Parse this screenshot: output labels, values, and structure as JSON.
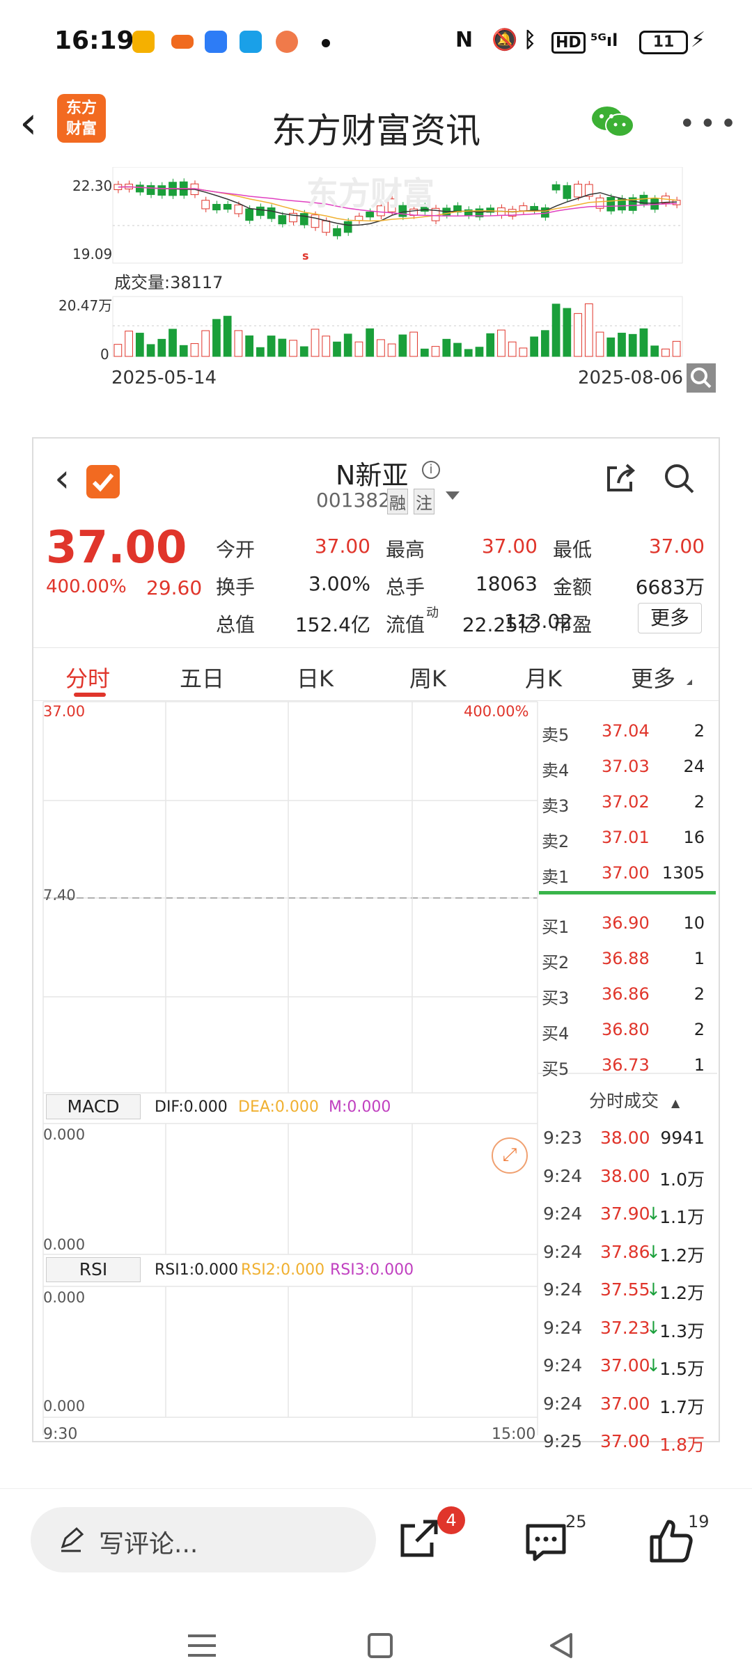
{
  "status": {
    "time": "16:19",
    "battery": "11"
  },
  "nav": {
    "title": "东方财富资讯",
    "logo_line1": "东方",
    "logo_line2": "财富"
  },
  "top_chart": {
    "watermark": "东方财富",
    "price_high": "22.30",
    "price_low": "19.09",
    "marker": "s",
    "volume_label": "成交量:38117",
    "vol_max": "20.47万",
    "vol_min": "0",
    "date_start": "2025-05-14",
    "date_end": "2025-08-06"
  },
  "stock": {
    "name": "N新亚",
    "code": "001382",
    "tag1": "融",
    "tag2": "注",
    "price": "37.00",
    "change_pct": "400.00%",
    "change": "29.60",
    "rows": [
      {
        "l1": "今开",
        "v1": "37.00",
        "l2": "最高",
        "v2": "37.00",
        "l3": "最低",
        "v3": "37.00"
      },
      {
        "l1": "换手",
        "v1": "3.00%",
        "l2": "总手",
        "v2": "18063",
        "l3": "金额",
        "v3": "6683万"
      },
      {
        "l1": "总值",
        "v1": "152.4亿",
        "l2": "流值",
        "v2": "22.25亿",
        "l3": "市盈",
        "v3": "113.02"
      }
    ],
    "pe_sup": "动",
    "more_button": "更多"
  },
  "tabs": [
    "分时",
    "五日",
    "日K",
    "周K",
    "月K",
    "更多"
  ],
  "intraday": {
    "top_left": "37.00",
    "top_right": "400.00%",
    "mid": "7.40",
    "time_start": "9:30",
    "time_end": "15:00"
  },
  "macd": {
    "label": "MACD",
    "dif": "DIF:0.000",
    "dea": "DEA:0.000",
    "m": "M:0.000",
    "top": "0.000",
    "bottom": "0.000"
  },
  "rsi": {
    "label": "RSI",
    "r1": "RSI1:0.000",
    "r2": "RSI2:0.000",
    "r3": "RSI3:0.000",
    "top": "0.000",
    "bottom": "0.000"
  },
  "order_book": {
    "sells": [
      {
        "label": "卖5",
        "price": "37.04",
        "vol": "2"
      },
      {
        "label": "卖4",
        "price": "37.03",
        "vol": "24"
      },
      {
        "label": "卖3",
        "price": "37.02",
        "vol": "2"
      },
      {
        "label": "卖2",
        "price": "37.01",
        "vol": "16"
      },
      {
        "label": "卖1",
        "price": "37.00",
        "vol": "1305"
      }
    ],
    "buys": [
      {
        "label": "买1",
        "price": "36.90",
        "vol": "10"
      },
      {
        "label": "买2",
        "price": "36.88",
        "vol": "1"
      },
      {
        "label": "买3",
        "price": "36.86",
        "vol": "2"
      },
      {
        "label": "买4",
        "price": "36.80",
        "vol": "2"
      },
      {
        "label": "买5",
        "price": "36.73",
        "vol": "1"
      }
    ]
  },
  "ticks": {
    "header": "分时成交",
    "rows": [
      {
        "t": "9:23",
        "p": "38.00",
        "arrow": "",
        "v": "9941",
        "vcolor": "#222"
      },
      {
        "t": "9:24",
        "p": "38.00",
        "arrow": "",
        "v": "1.0万",
        "vcolor": "#222"
      },
      {
        "t": "9:24",
        "p": "37.90",
        "arrow": "↓",
        "v": "1.1万",
        "vcolor": "#222"
      },
      {
        "t": "9:24",
        "p": "37.86",
        "arrow": "↓",
        "v": "1.2万",
        "vcolor": "#222"
      },
      {
        "t": "9:24",
        "p": "37.55",
        "arrow": "↓",
        "v": "1.2万",
        "vcolor": "#222"
      },
      {
        "t": "9:24",
        "p": "37.23",
        "arrow": "↓",
        "v": "1.3万",
        "vcolor": "#222"
      },
      {
        "t": "9:24",
        "p": "37.00",
        "arrow": "↓",
        "v": "1.5万",
        "vcolor": "#222"
      },
      {
        "t": "9:24",
        "p": "37.00",
        "arrow": "",
        "v": "1.7万",
        "vcolor": "#222"
      },
      {
        "t": "9:25",
        "p": "37.00",
        "arrow": "",
        "v": "1.8万",
        "vcolor": "#e0352b"
      }
    ]
  },
  "bottom": {
    "comment_placeholder": "写评论...",
    "share_badge": "4",
    "comments_count": "25",
    "likes_count": "19"
  },
  "colors": {
    "red": "#e0352b",
    "green": "#1a9f3a",
    "accent": "#f26a21"
  }
}
